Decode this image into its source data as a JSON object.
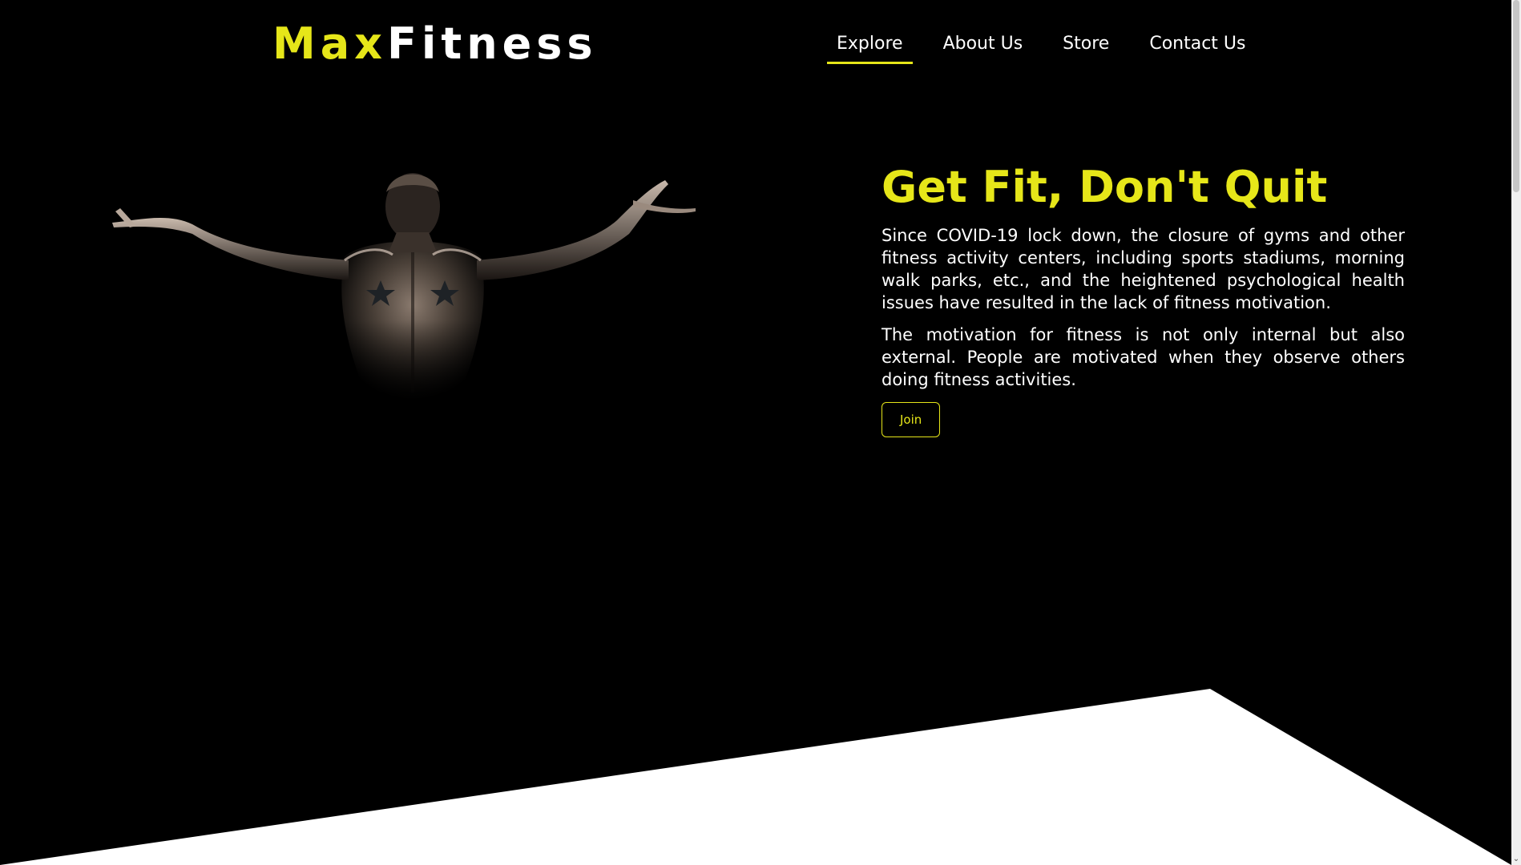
{
  "brand": {
    "name_part1": "Max",
    "name_part2": "Fitness",
    "accent_color": "#e6e619"
  },
  "nav": {
    "items": [
      {
        "label": "Explore",
        "active": true
      },
      {
        "label": "About Us",
        "active": false
      },
      {
        "label": "Store",
        "active": false
      },
      {
        "label": "Contact Us",
        "active": false
      }
    ]
  },
  "hero": {
    "title": "Get Fit, Don't Quit",
    "paragraph1": "Since COVID-19 lock down, the closure of gyms and other fitness activity centers, including sports stadiums, morning walk parks, etc., and the heightened psychological health issues have resulted in the lack of fitness motivation.",
    "paragraph2": "The motivation for fitness is not only internal but also external. People are motivated when they observe others doing fitness activities.",
    "join_label": "Join"
  },
  "scrollbar": {
    "down_arrow_icon": "chevron-down-icon"
  }
}
